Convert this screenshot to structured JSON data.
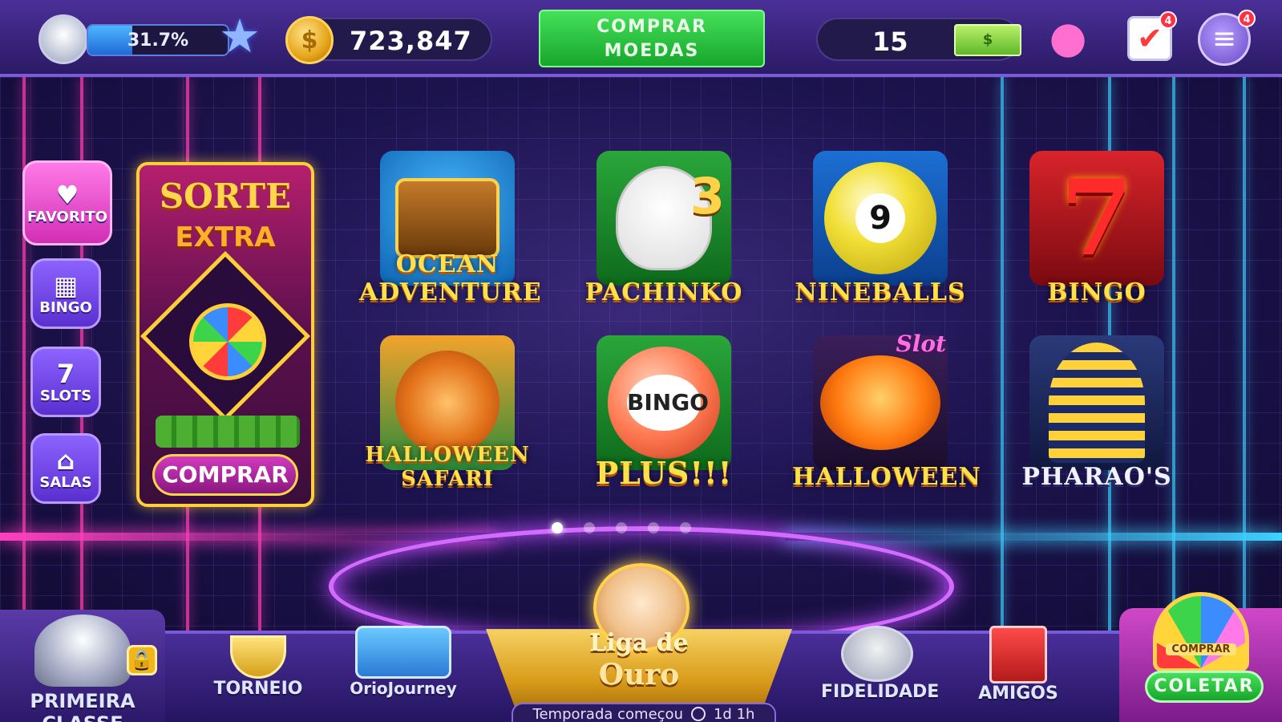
{
  "topbar": {
    "xp_percent_label": "31.7%",
    "xp_progress": 0.317,
    "coins": "723,847",
    "buy_coins_line1": "COMPRAR",
    "buy_coins_line2": "MOEDAS",
    "tickets": "15",
    "tasks_badge": "4",
    "menu_badge": "4"
  },
  "left_nav": [
    {
      "label": "FAVORITO",
      "icon": "heart-icon"
    },
    {
      "label": "BINGO",
      "icon": "bingo-card-icon"
    },
    {
      "label": "SLOTS",
      "icon": "slot-machine-icon"
    },
    {
      "label": "SALAS",
      "icon": "house-icon"
    }
  ],
  "promo": {
    "title": "SORTE",
    "subtitle": "EXTRA",
    "button": "COMPRAR"
  },
  "games": [
    {
      "label": "OCEAN ADVENTURE"
    },
    {
      "label": "PACHINKO",
      "tag": "3"
    },
    {
      "label": "NINEBALLS",
      "ball": "9"
    },
    {
      "label": "BINGO",
      "symbol": "7"
    },
    {
      "label": "HALLOWEEN SAFARI"
    },
    {
      "label": "PLUS!!!",
      "ball": "BINGO"
    },
    {
      "label": "HALLOWEEN",
      "tag": "Slot"
    },
    {
      "label": "PHARAO'S"
    }
  ],
  "pagination": {
    "pages": 5,
    "active": 1
  },
  "bottom_nav": {
    "first_class": "PRIMEIRA CLASSE",
    "tournament": "TORNEIO",
    "journey": "OrioJourney",
    "league_title": "Liga de",
    "league_sub": "Ouro",
    "season_text": "Temporada começou",
    "season_time": "1d 1h",
    "loyalty": "FIDELIDADE",
    "friends": "AMIGOS",
    "wheel_buy": "COMPRAR",
    "collect": "COLETAR"
  },
  "colors": {
    "bg": "#1a0f3d",
    "accent_green": "#17a62b",
    "accent_pink": "#d12fb3",
    "gold": "#ffd24a"
  }
}
